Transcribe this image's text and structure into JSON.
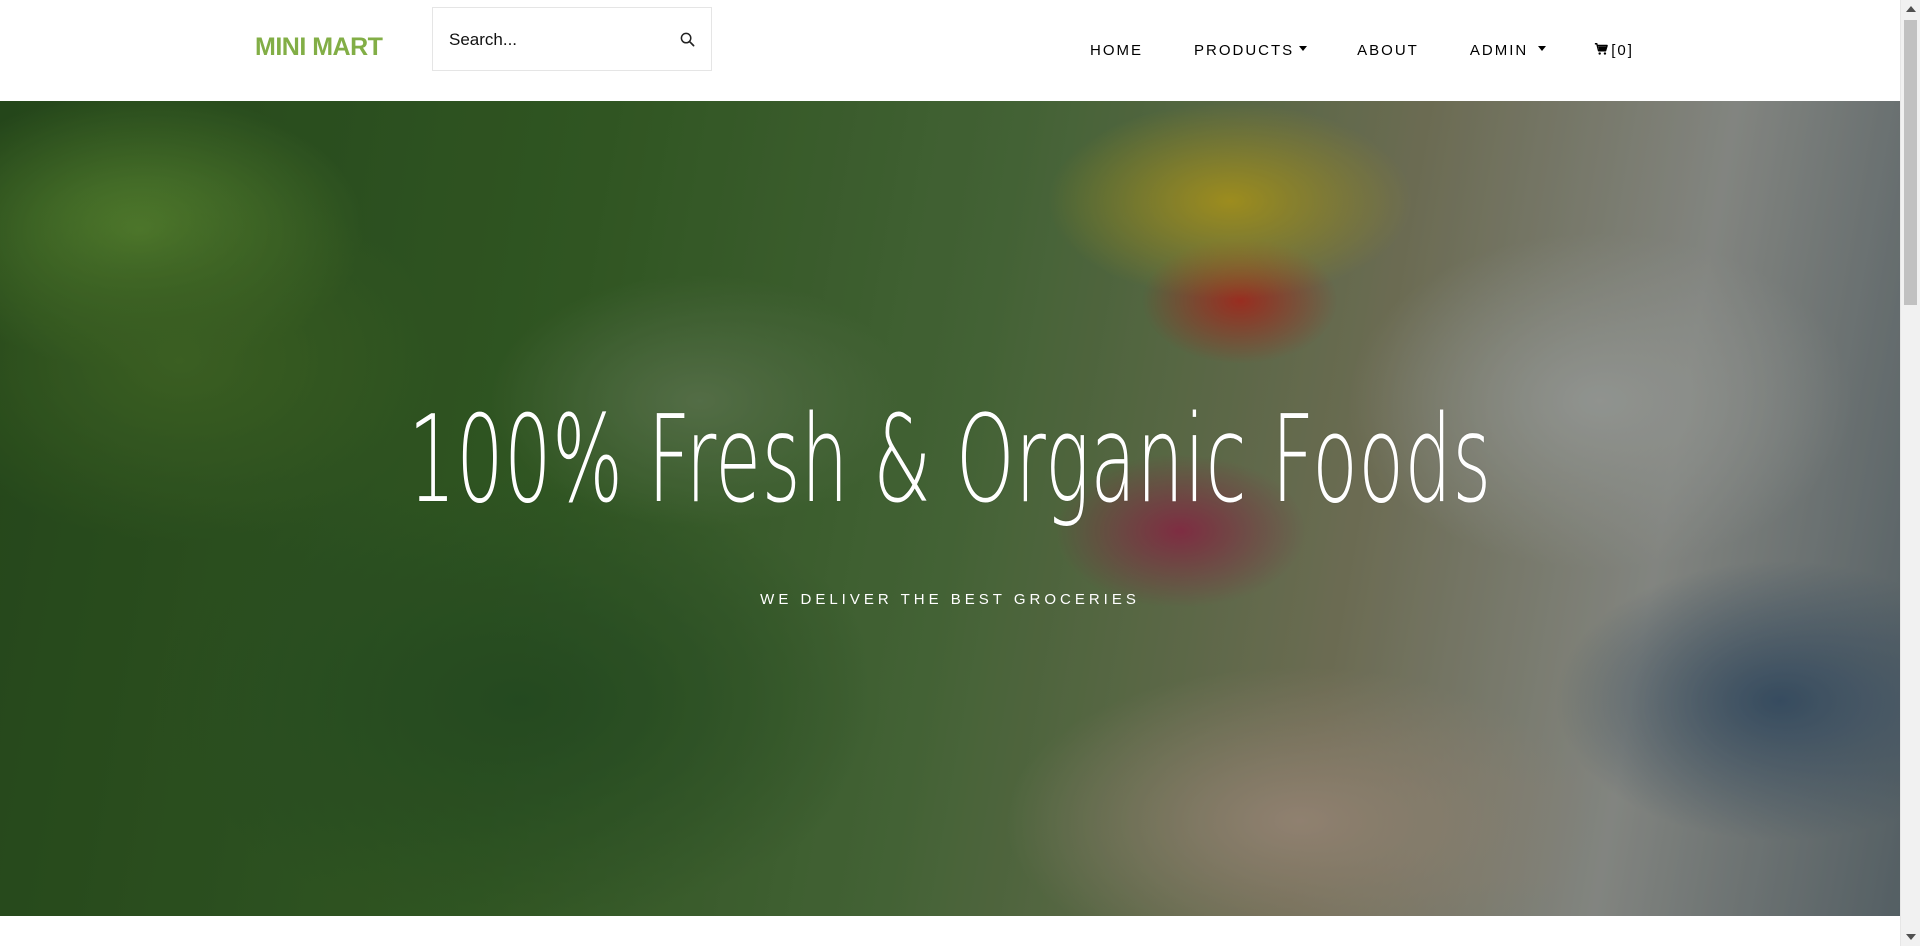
{
  "brand": {
    "name": "MINI MART",
    "color": "#82ae46"
  },
  "search": {
    "placeholder": "Search...",
    "icon": "search-icon"
  },
  "nav": {
    "items": [
      {
        "label": "HOME",
        "dropdown": false
      },
      {
        "label": "PRODUCTS",
        "dropdown": true
      },
      {
        "label": "ABOUT",
        "dropdown": false
      },
      {
        "label": "ADMIN",
        "dropdown": true
      }
    ],
    "cart": {
      "icon": "shopping-cart-icon",
      "count_text": "[0]"
    }
  },
  "hero": {
    "title": "100% Fresh & Organic Foods",
    "subtitle": "WE DELIVER THE BEST GROCERIES"
  }
}
